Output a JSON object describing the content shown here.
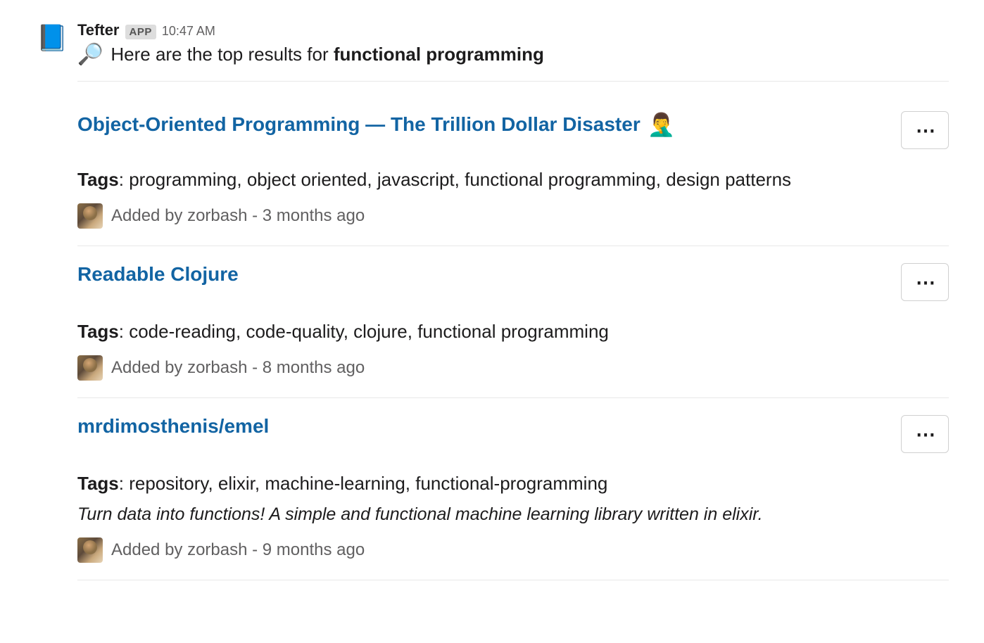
{
  "header": {
    "sender": "Tefter",
    "badge": "APP",
    "timestamp": "10:47 AM",
    "avatar_emoji": "📘"
  },
  "intro": {
    "search_emoji": "🔍",
    "prefix": "Here are the top results for ",
    "query": "functional programming"
  },
  "results": [
    {
      "title": "Object-Oriented Programming — The Trillion Dollar Disaster",
      "emoji": "🤦‍♂️",
      "tags_label": "Tags",
      "tags": "programming, object oriented, javascript, functional programming, design patterns",
      "description": "",
      "added_by": "Added by zorbash - 3 months ago"
    },
    {
      "title": "Readable Clojure",
      "emoji": "",
      "tags_label": "Tags",
      "tags": "code-reading, code-quality, clojure, functional programming",
      "description": "",
      "added_by": "Added by zorbash - 8 months ago"
    },
    {
      "title": "mrdimosthenis/emel",
      "emoji": "",
      "tags_label": "Tags",
      "tags": "repository, elixir, machine-learning, functional-programming",
      "description": "Turn data into functions! A simple and functional machine learning library written in elixir.",
      "added_by": "Added by zorbash - 9 months ago"
    }
  ],
  "more_button_label": "⋯"
}
